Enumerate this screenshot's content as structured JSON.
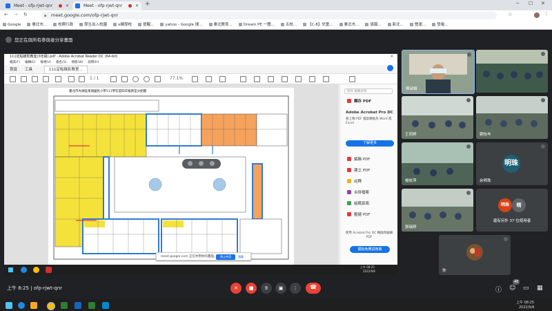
{
  "browser": {
    "tabs": [
      {
        "label": "Meet - ofp-rjwt-qnr",
        "active": false
      },
      {
        "label": "Meet - ofp-rjwt-qnr",
        "active": true
      }
    ],
    "url": "meet.google.com/ofp-rjwt-qnr",
    "bookmarks": [
      "Google",
      "臺北市...",
      "校務行政",
      "學生出入校園",
      "e網學校",
      "提醒...",
      "yahoo - Google 搜...",
      "臺北教育...",
      "Dream PE 一體...",
      "五校...",
      "【C-8】兒童...",
      "臺北市...",
      "填報...",
      "新北...",
      "營運...",
      "發電..."
    ]
  },
  "meet": {
    "presenting_banner": "您正在與所有參與者分享畫面",
    "time": "上午 8:25",
    "meeting_code": "ofp-rjwt-qnr",
    "participant_count": "48",
    "more_participants": "還有另外 37 位使用者"
  },
  "acrobat": {
    "window_title": "111定點錄影教室(3年級).pdf - Adobe Acrobat Reader DC (64-bit)",
    "menu": [
      "檔案(F)",
      "編輯(E)",
      "檢視(V)",
      "簽名(S)",
      "視窗(W)",
      "說明(H)"
    ],
    "tabs": [
      "首頁",
      "工具",
      "111定點錄影教室..."
    ],
    "page_indicator": "1 / 1",
    "zoom": "77.1%",
    "doc_title": "臺北市內湖區東湖國民小學111學年度四年級教室分配圖",
    "search_placeholder": "搜尋 編輯表格",
    "convert_label": "轉存 PDF",
    "promo_title": "Adobe Acrobat Pro DC",
    "promo_text": "將上傳 PDF 檔案轉換為 Word 或 Excel",
    "learn_more": "了解更多",
    "tools": [
      "編輯 PDF",
      "建立 PDF",
      "註釋",
      "合併檔案",
      "組織頁面",
      "壓縮 PDF"
    ],
    "trial_text": "使用 Acrobat Pro DC 轉換和編輯 PDF",
    "trial_button": "開始免費試用版",
    "share_notice": "meet.google.com 正在共用你的畫面。",
    "stop_share": "停止共用",
    "hide_share": "隱藏",
    "inner_clock": "上午 08:25",
    "inner_date": "2022/9/6"
  },
  "participants": [
    {
      "name": "陳淑娟",
      "type": "video"
    },
    {
      "name": "",
      "type": "video"
    },
    {
      "name": "",
      "type": "video"
    },
    {
      "name": "王莉婷",
      "type": "video"
    },
    {
      "name": "劉怡岑",
      "type": "video"
    },
    {
      "name": "楊依萍",
      "type": "video"
    },
    {
      "name": "余明珠",
      "type": "avatar",
      "avatar_text": "明珠",
      "avatar_color": "#1e5f74"
    },
    {
      "name": "張瑞婷",
      "type": "video"
    },
    {
      "name": "",
      "type": "avatar_pair",
      "avatar_text": "明珠",
      "avatar_text2": "晴"
    },
    {
      "name": "你",
      "type": "self"
    }
  ],
  "taskbar": {
    "clock": "上午 08:25",
    "date": "2022/9/6"
  },
  "colors": {
    "accent": "#1a73e8",
    "danger": "#ea4335",
    "pdf_yellow": "#f4e23b",
    "pdf_blue": "#2f7bd1",
    "pdf_orange": "#f5a25d"
  }
}
